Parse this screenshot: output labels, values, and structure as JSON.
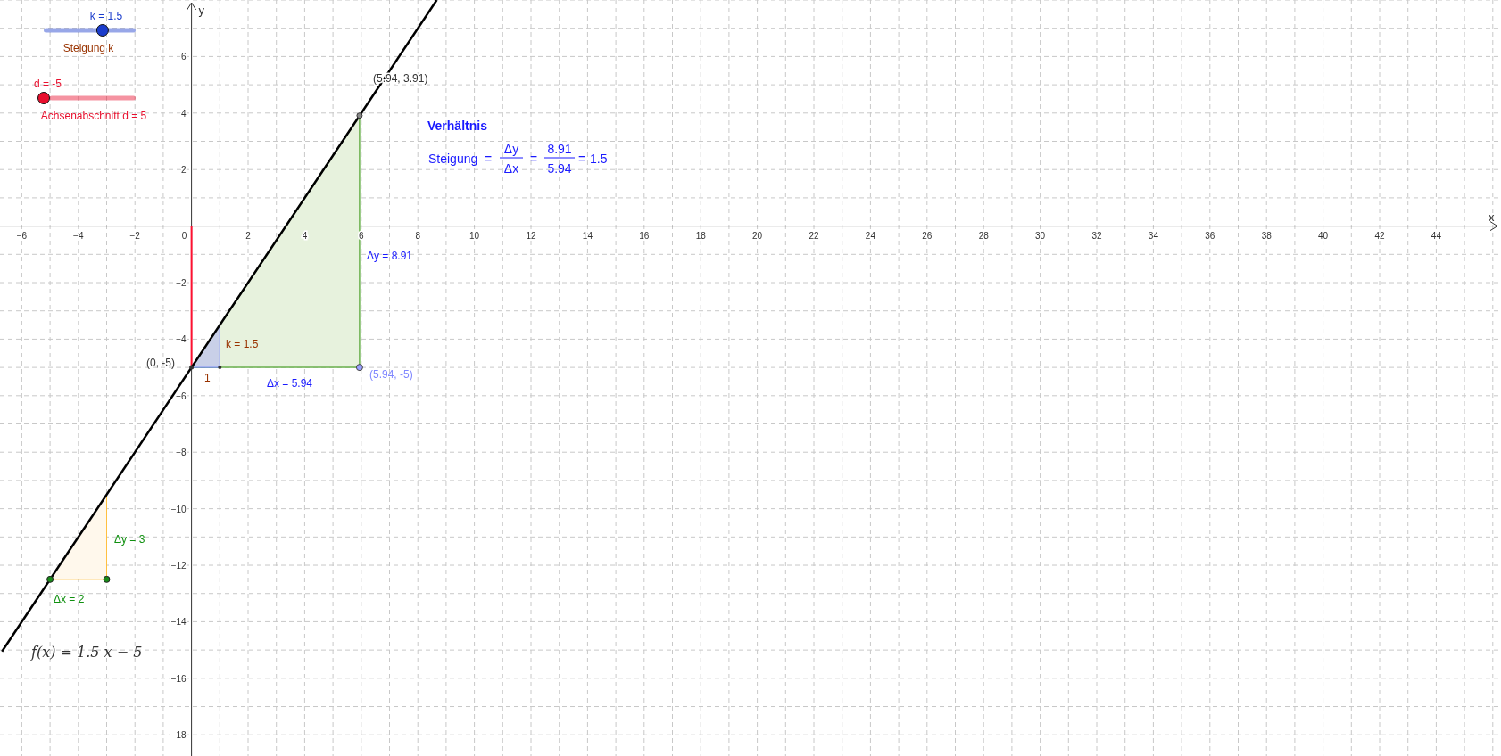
{
  "sliders": [
    {
      "value_label": "k = 1.5",
      "caption": "Steigung k",
      "level": 0.64,
      "color": "#1a3ccc"
    },
    {
      "value_label": "d = -5",
      "caption": "Achsenabschnitt d = 5",
      "level": 0,
      "color": "#e8102e"
    }
  ],
  "graph": {
    "chart_data": {
      "type": "line",
      "xlabel": "x",
      "ylabel": "y",
      "grid": true,
      "x": [
        -6.7,
        8.67
      ],
      "series": [
        {
          "name": "f(x) = 1.5 x − 5",
          "color": "#000000",
          "values": [
            -15.05,
            8
          ]
        }
      ],
      "xlim": [
        -6.77,
        46.29
      ],
      "ylim": [
        -18.75,
        8
      ],
      "xticks": [
        {
          "value": -6,
          "label": "−6"
        },
        {
          "value": -4,
          "label": "−4"
        },
        {
          "value": -2,
          "label": "−2"
        },
        0,
        2,
        4,
        6,
        8,
        10,
        12,
        14,
        16,
        18,
        20,
        22,
        24,
        26,
        28,
        30,
        32,
        34,
        36,
        38,
        40,
        42,
        44
      ],
      "yticks": [
        6,
        4,
        2,
        {
          "value": -2,
          "label": "−2"
        },
        {
          "value": -4,
          "label": "−4"
        },
        {
          "value": -6,
          "label": "−6"
        },
        {
          "value": -8,
          "label": "−8"
        },
        {
          "value": -10,
          "label": "−10"
        },
        {
          "value": -12,
          "label": "−12"
        },
        {
          "value": -14,
          "label": "−14"
        },
        {
          "value": -16,
          "label": "−16"
        },
        {
          "value": -18,
          "label": "−18"
        }
      ]
    }
  },
  "labels": {
    "point_top": "(5.94, 3.91)",
    "delta_y": "Δy = 8.91",
    "intercept_point": "(0, -5)",
    "k_label": "k = 1.5",
    "unit_label": "1",
    "delta_x": "Δx = 5.94",
    "point_bottom": "(5.94, -5)",
    "small_dy": "Δy = 3",
    "small_dx": "Δx = 2"
  },
  "ratio": {
    "title": "Verhältnis",
    "lhs": "Steigung",
    "eq1": "=",
    "num": "Δy",
    "den": "Δx",
    "eq2": "=",
    "num2": "8.91",
    "den2": "5.94",
    "eq3": "=",
    "result": "1.5"
  }
}
